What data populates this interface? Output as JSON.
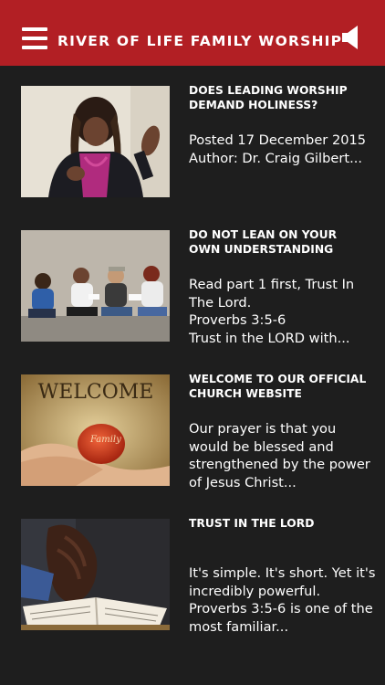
{
  "header": {
    "title": "RIVER OF LIFE FAMILY WORSHIP",
    "menu_icon": "hamburger-menu-icon",
    "speaker_icon": "speaker-icon",
    "background_color": "#b21f24"
  },
  "posts": [
    {
      "title": "DOES LEADING WORSHIP DEMAND HOLINESS?",
      "excerpt": "Posted 17 December 2015    Author: Dr. Craig Gilbert..."
    },
    {
      "title": "DO NOT LEAN ON YOUR OWN UNDERSTANDING",
      "excerpt": "Read part 1 first, Trust In The Lord.\nProverbs 3:5-6\nTrust in the LORD with..."
    },
    {
      "title": "WELCOME TO OUR OFFICIAL CHURCH WEBSITE",
      "excerpt": "Our prayer is that you would be blessed and strengthened by the power of Jesus Christ..."
    },
    {
      "title": "TRUST IN THE LORD",
      "excerpt": "It's simple. It's short. Yet it's incredibly powerful. Proverbs 3:5-6 is one of the most familiar..."
    }
  ],
  "thumbnails": {
    "welcome_text": "WELCOME",
    "family_text": "Family"
  }
}
